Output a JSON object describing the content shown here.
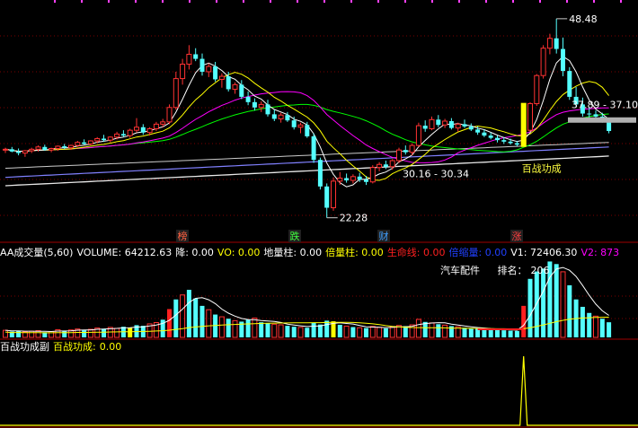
{
  "main_panel": {
    "high_label": "48.48",
    "low_label": "22.28",
    "range_label_1": "37.89 - 37.10",
    "range_label_2": "30.16 - 30.34",
    "signal_label": "百战功成",
    "markers": [
      "榜",
      "跌",
      "财",
      "涨"
    ]
  },
  "volume_panel": {
    "indicator_name": "AA成交量(5,60)",
    "items": [
      {
        "label": "VOLUME:",
        "value": "64212.63",
        "color": "#ffffff"
      },
      {
        "label": "降:",
        "value": "0.00",
        "color": "#ffffff"
      },
      {
        "label": "VO:",
        "value": "0.00",
        "color": "#ffff00"
      },
      {
        "label": "地量柱:",
        "value": "0.00",
        "color": "#ffffff"
      },
      {
        "label": "倍量柱:",
        "value": "0.00",
        "color": "#ffff00"
      },
      {
        "label": "生命线:",
        "value": "0.00",
        "color": "#ff2020"
      },
      {
        "label": "倍缩量:",
        "value": "0.00",
        "color": "#2040ff"
      },
      {
        "label": "V1:",
        "value": "72406.30",
        "color": "#ffffff"
      },
      {
        "label": "V2:",
        "value": "873",
        "color": "#ff00ff"
      }
    ],
    "sector_label": "汽车配件",
    "rank_label": "排名：",
    "rank_value": "206"
  },
  "sub_panel": {
    "indicator_name": "百战功成副",
    "item_label": "百战功成:",
    "item_value": "0.00"
  },
  "colors": {
    "up": "#ff3232",
    "down": "#54ffff",
    "ma5": "#ffffff",
    "ma10": "#ffff00",
    "ma20": "#ff00ff",
    "ma30": "#00ff00",
    "ma60": "#8080ff",
    "signal": "#ffff00"
  },
  "chart_data": {
    "type": "candlestick",
    "ylim": [
      20,
      50
    ],
    "high": 48.48,
    "low": 22.28,
    "candles": [
      [
        31.2,
        31.5,
        30.8,
        31.3
      ],
      [
        31.3,
        31.6,
        30.9,
        31.0
      ],
      [
        31.0,
        31.4,
        30.5,
        30.8
      ],
      [
        30.8,
        31.2,
        30.3,
        31.1
      ],
      [
        31.1,
        31.5,
        30.8,
        31.3
      ],
      [
        31.3,
        31.8,
        31.0,
        31.6
      ],
      [
        31.6,
        31.9,
        31.1,
        31.2
      ],
      [
        31.2,
        31.5,
        30.9,
        31.4
      ],
      [
        31.4,
        31.8,
        31.1,
        31.7
      ],
      [
        31.7,
        32.0,
        31.3,
        31.5
      ],
      [
        31.5,
        31.9,
        31.2,
        31.8
      ],
      [
        31.8,
        32.4,
        31.6,
        32.2
      ],
      [
        32.2,
        32.6,
        31.9,
        32.0
      ],
      [
        32.0,
        32.5,
        31.8,
        32.4
      ],
      [
        32.4,
        32.9,
        32.1,
        32.7
      ],
      [
        32.7,
        33.2,
        32.3,
        32.5
      ],
      [
        32.5,
        33.0,
        32.2,
        32.9
      ],
      [
        32.9,
        33.6,
        32.6,
        33.3
      ],
      [
        33.3,
        33.8,
        32.9,
        33.1
      ],
      [
        33.1,
        34.0,
        32.8,
        33.8
      ],
      [
        33.8,
        35.4,
        33.5,
        34.2
      ],
      [
        34.2,
        34.6,
        33.2,
        33.5
      ],
      [
        33.5,
        34.2,
        33.1,
        34.0
      ],
      [
        34.0,
        34.9,
        33.7,
        34.6
      ],
      [
        34.6,
        35.3,
        34.2,
        34.9
      ],
      [
        34.9,
        37.2,
        34.6,
        36.8
      ],
      [
        36.8,
        41.5,
        36.5,
        40.6
      ],
      [
        40.6,
        43.2,
        39.8,
        42.5
      ],
      [
        42.5,
        45.0,
        41.8,
        43.8
      ],
      [
        43.8,
        44.6,
        42.9,
        43.2
      ],
      [
        43.2,
        43.9,
        41.0,
        41.5
      ],
      [
        41.5,
        42.6,
        40.8,
        42.2
      ],
      [
        42.2,
        42.8,
        40.2,
        40.5
      ],
      [
        40.5,
        41.3,
        39.4,
        40.9
      ],
      [
        40.9,
        41.5,
        38.9,
        39.2
      ],
      [
        39.2,
        40.1,
        38.6,
        39.8
      ],
      [
        39.8,
        40.4,
        37.9,
        38.2
      ],
      [
        38.2,
        38.9,
        37.1,
        37.5
      ],
      [
        37.5,
        38.0,
        36.4,
        36.8
      ],
      [
        36.8,
        37.6,
        36.2,
        37.2
      ],
      [
        37.2,
        37.8,
        35.6,
        35.9
      ],
      [
        35.9,
        36.5,
        35.0,
        35.3
      ],
      [
        35.3,
        36.1,
        34.8,
        35.8
      ],
      [
        35.8,
        36.2,
        34.9,
        35.1
      ],
      [
        35.1,
        35.6,
        33.9,
        34.2
      ],
      [
        34.2,
        34.8,
        33.4,
        34.5
      ],
      [
        34.5,
        34.9,
        32.8,
        33.0
      ],
      [
        33.0,
        33.4,
        29.5,
        29.9
      ],
      [
        29.9,
        30.2,
        26.0,
        26.4
      ],
      [
        26.4,
        26.8,
        22.28,
        23.6
      ],
      [
        23.6,
        27.6,
        23.2,
        27.1
      ],
      [
        27.1,
        28.3,
        26.6,
        27.5
      ],
      [
        27.5,
        28.1,
        26.9,
        27.2
      ],
      [
        27.2,
        28.0,
        26.8,
        27.7
      ],
      [
        27.7,
        28.2,
        27.0,
        27.3
      ],
      [
        27.3,
        27.8,
        26.6,
        27.0
      ],
      [
        27.0,
        29.2,
        26.8,
        28.9
      ],
      [
        28.9,
        29.6,
        28.4,
        29.3
      ],
      [
        29.3,
        29.8,
        28.7,
        29.0
      ],
      [
        29.0,
        30.0,
        28.6,
        29.8
      ],
      [
        29.8,
        31.5,
        29.5,
        31.2
      ],
      [
        31.2,
        31.8,
        30.6,
        30.9
      ],
      [
        30.9,
        32.1,
        30.5,
        31.8
      ],
      [
        31.8,
        34.8,
        31.6,
        34.4
      ],
      [
        34.4,
        35.1,
        33.6,
        34.0
      ],
      [
        34.0,
        35.6,
        33.8,
        35.2
      ],
      [
        35.2,
        35.8,
        34.2,
        34.5
      ],
      [
        34.5,
        35.3,
        34.1,
        35.0
      ],
      [
        35.0,
        35.4,
        33.9,
        34.1
      ],
      [
        34.1,
        34.8,
        33.6,
        34.6
      ],
      [
        34.6,
        35.2,
        34.1,
        34.3
      ],
      [
        34.3,
        34.7,
        33.7,
        33.9
      ],
      [
        33.9,
        34.3,
        33.2,
        33.5
      ],
      [
        33.5,
        33.9,
        32.9,
        33.1
      ],
      [
        33.1,
        33.5,
        32.6,
        32.8
      ],
      [
        32.8,
        33.1,
        32.2,
        32.5
      ],
      [
        32.5,
        32.9,
        32.0,
        32.3
      ],
      [
        32.3,
        32.7,
        31.9,
        32.1
      ],
      [
        32.1,
        32.4,
        31.7,
        31.9
      ],
      [
        31.9,
        34.0,
        31.8,
        33.8
      ],
      [
        33.8,
        37.5,
        33.6,
        37.3
      ],
      [
        37.3,
        41.2,
        37.0,
        41.0
      ],
      [
        41.0,
        45.0,
        40.6,
        44.6
      ],
      [
        44.6,
        46.5,
        43.8,
        45.9
      ],
      [
        45.9,
        48.48,
        43.9,
        44.5
      ],
      [
        44.5,
        46.0,
        40.9,
        41.6
      ],
      [
        41.6,
        42.1,
        37.8,
        38.2
      ],
      [
        38.2,
        39.5,
        36.9,
        37.2
      ],
      [
        37.2,
        38.1,
        35.6,
        36.0
      ],
      [
        36.0,
        36.8,
        35.3,
        35.9
      ],
      [
        35.9,
        36.4,
        35.1,
        35.6
      ],
      [
        35.6,
        36.1,
        34.8,
        35.0
      ],
      [
        35.0,
        35.2,
        33.4,
        33.7
      ]
    ],
    "volumes": [
      22,
      18,
      20,
      17,
      19,
      21,
      16,
      18,
      24,
      20,
      23,
      26,
      22,
      25,
      29,
      27,
      31,
      28,
      33,
      30,
      38,
      36,
      42,
      46,
      55,
      88,
      118,
      132,
      148,
      121,
      98,
      86,
      71,
      64,
      58,
      52,
      49,
      55,
      60,
      47,
      44,
      41,
      39,
      36,
      33,
      31,
      30,
      45,
      40,
      52,
      50,
      39,
      35,
      32,
      30,
      29,
      34,
      31,
      28,
      33,
      37,
      35,
      39,
      56,
      48,
      45,
      41,
      38,
      35,
      33,
      30,
      29,
      27,
      26,
      25,
      24,
      22,
      21,
      20,
      98,
      182,
      205,
      214,
      236,
      228,
      204,
      162,
      118,
      95,
      76,
      66,
      58,
      47
    ],
    "volume_colors": [
      "u",
      "d",
      "d",
      "u",
      "u",
      "u",
      "d",
      "u",
      "u",
      "d",
      "u",
      "u",
      "d",
      "u",
      "u",
      "d",
      "u",
      "u",
      "d",
      "y",
      "d",
      "d",
      "u",
      "u",
      "d",
      "R",
      "d",
      "u",
      "d",
      "d",
      "d",
      "u",
      "d",
      "u",
      "d",
      "u",
      "d",
      "d",
      "u",
      "d",
      "d",
      "u",
      "u",
      "d",
      "d",
      "u",
      "d",
      "d",
      "d",
      "d",
      "y",
      "d",
      "u",
      "d",
      "u",
      "d",
      "u",
      "u",
      "d",
      "u",
      "u",
      "d",
      "u",
      "u",
      "d",
      "u",
      "d",
      "u",
      "d",
      "u",
      "d",
      "d",
      "d",
      "d",
      "d",
      "d",
      "d",
      "d",
      "d",
      "R",
      "d",
      "d",
      "d",
      "d",
      "d",
      "u",
      "d",
      "d",
      "d",
      "d",
      "u",
      "d",
      "d"
    ],
    "signal_index": 79,
    "series": [
      {
        "name": "百战功成",
        "values_note": "spike at signal_index"
      }
    ]
  }
}
